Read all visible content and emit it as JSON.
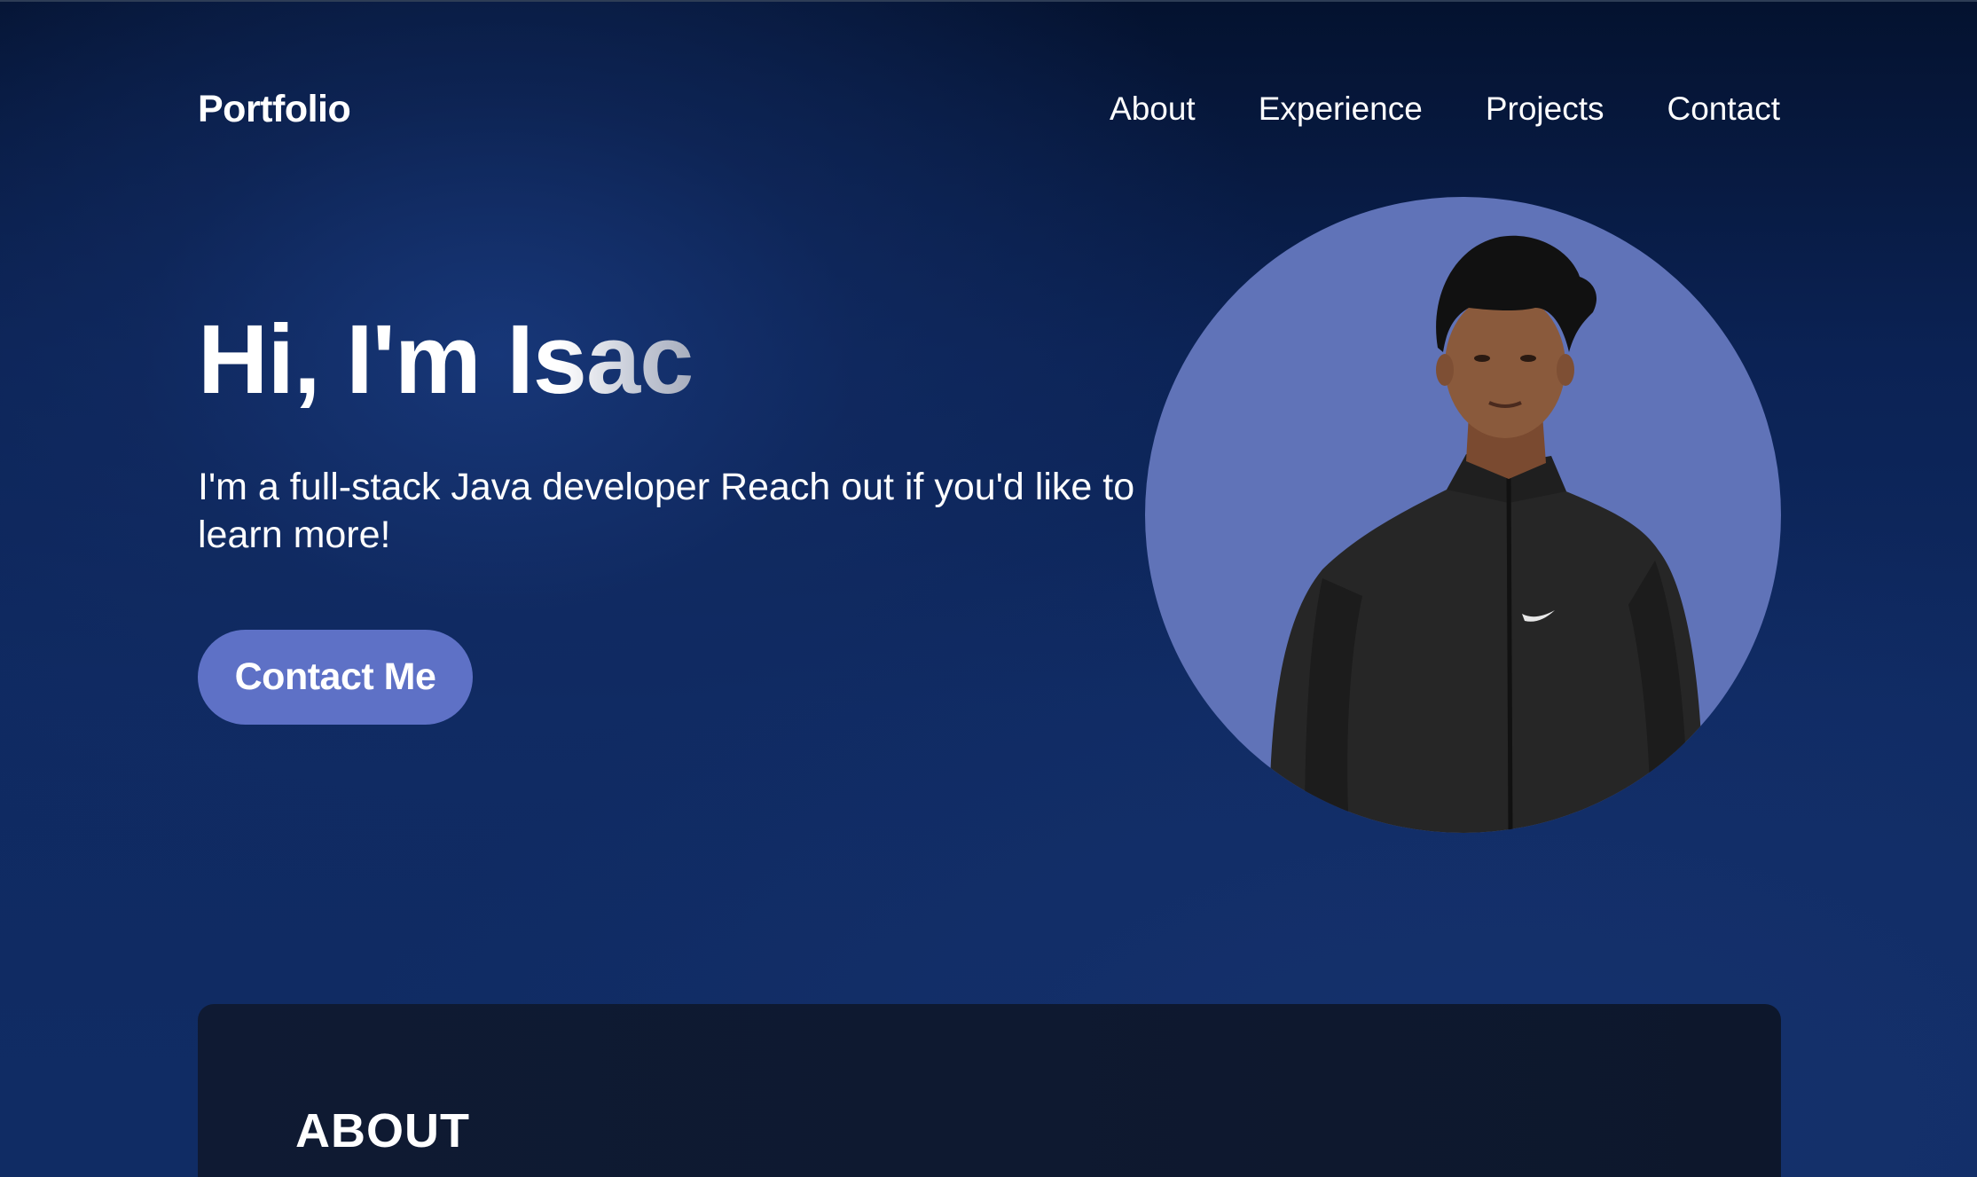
{
  "nav": {
    "brand": "Portfolio",
    "links": [
      "About",
      "Experience",
      "Projects",
      "Contact"
    ]
  },
  "hero": {
    "title": "Hi, I'm Isac",
    "subtitle": "I'm a full-stack Java developer Reach out if you'd like to learn more!",
    "cta_label": "Contact Me"
  },
  "about": {
    "heading": "ABOUT"
  },
  "colors": {
    "accent": "#5e71c6",
    "avatar_bg": "#6073b8",
    "background": "#0b2254",
    "card": "#0f1a33"
  }
}
